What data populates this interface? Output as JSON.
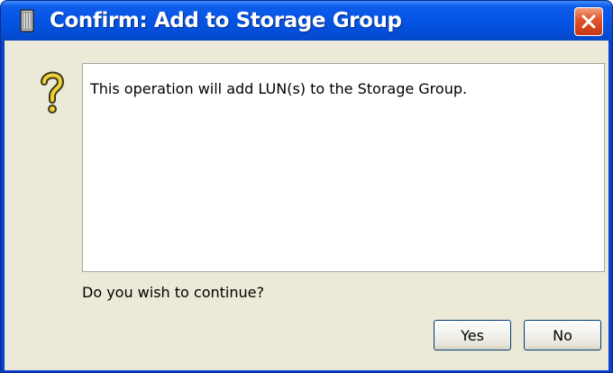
{
  "window": {
    "title": "Confirm: Add to Storage Group",
    "title_icon": "storage-array-icon",
    "close_icon": "close-x-icon"
  },
  "dialog": {
    "icon": "question-mark-icon",
    "message": "This operation will add LUN(s) to the Storage Group.",
    "prompt": "Do you wish to continue?"
  },
  "buttons": {
    "yes_label": "Yes",
    "no_label": "No"
  },
  "colors": {
    "titlebar": "#0655e6",
    "close": "#e2572d",
    "client_bg": "#ece9d8",
    "question_icon": "#f2d03a"
  }
}
